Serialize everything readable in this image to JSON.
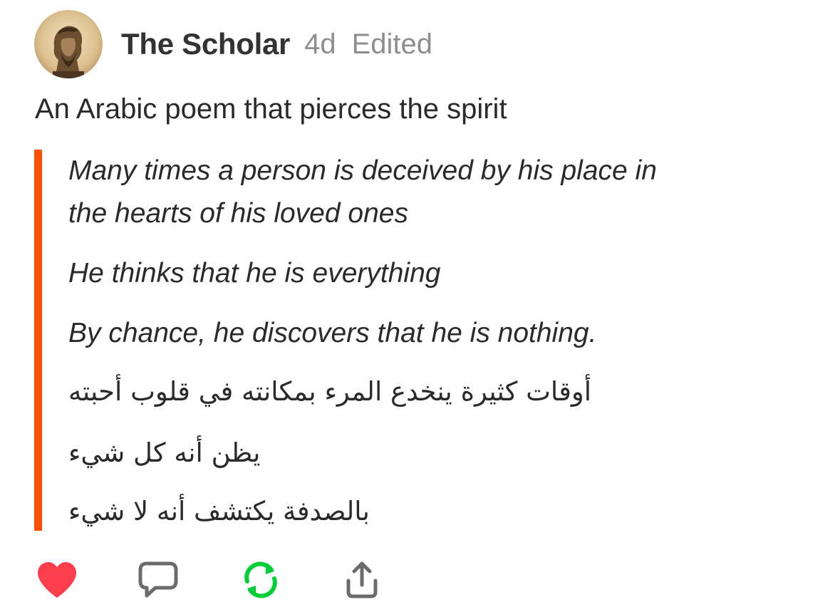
{
  "post": {
    "author": "The Scholar",
    "age": "4d",
    "edited_label": "Edited",
    "title": "An Arabic poem that pierces the spirit",
    "quote": {
      "english": [
        "Many times a person is deceived by his place in",
        "the hearts of his loved ones",
        "He thinks that he is everything",
        "By chance, he discovers that he is nothing."
      ],
      "arabic": [
        "أوقات كثيرة ينخدع المرء بمكانته في قلوب أحبته",
        "يظن أنه كل شيء",
        "بالصدفة يكتشف أنه لا شيء"
      ]
    }
  },
  "actions": {
    "icons": [
      "heart-icon",
      "comment-icon",
      "reblog-icon",
      "share-icon"
    ]
  },
  "colors": {
    "quote_bar": "#ff4f00",
    "heart": "#ff3e4d",
    "reblog": "#00cf35",
    "icon_gray": "#6b6b6b"
  }
}
